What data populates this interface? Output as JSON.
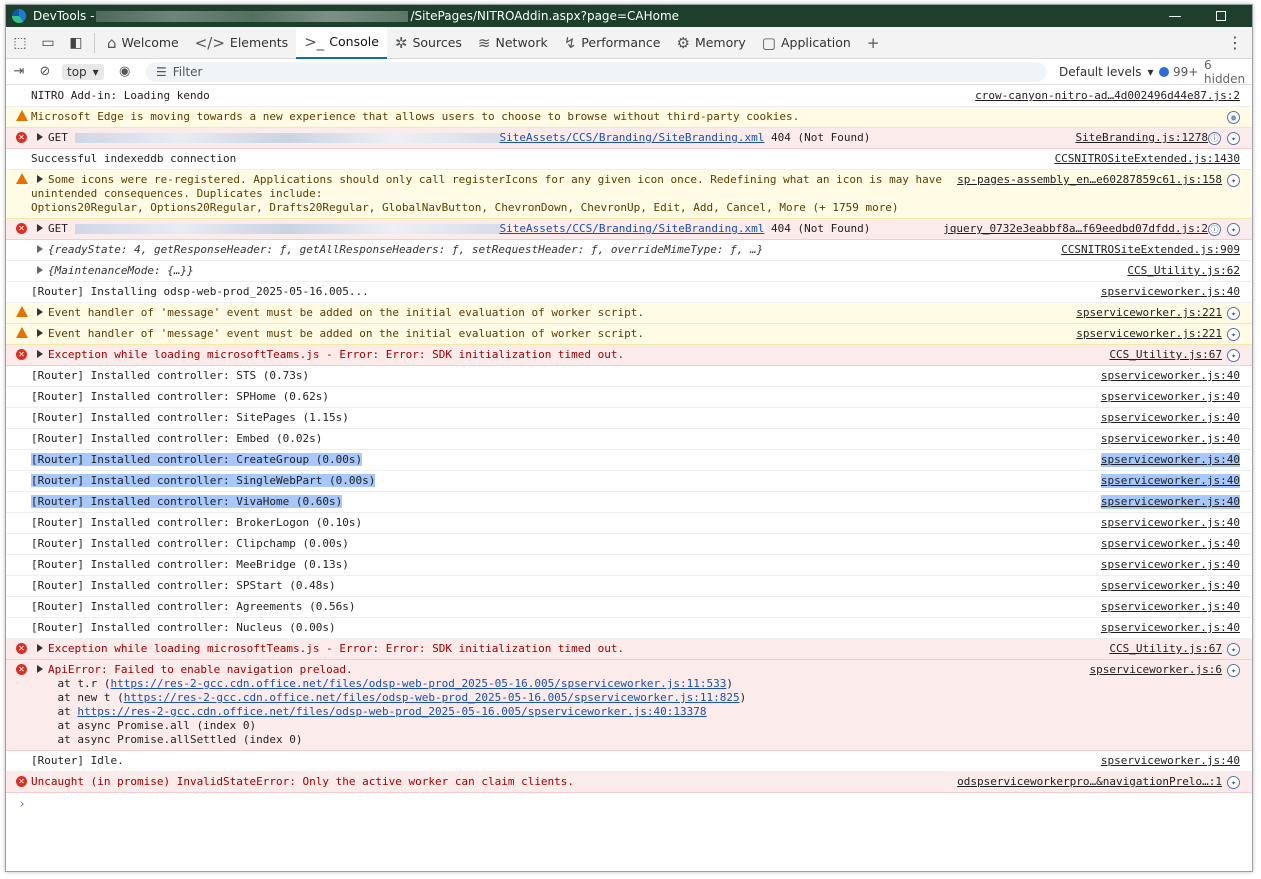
{
  "window": {
    "title_prefix": "DevTools - ",
    "title_suffix": "/SitePages/NITROAddin.aspx?page=CAHome",
    "min_symbol": "—",
    "max_symbol": ""
  },
  "tabs": [
    {
      "label": "Welcome",
      "icon": "home-icon"
    },
    {
      "label": "Elements",
      "icon": "code-icon"
    },
    {
      "label": "Console",
      "icon": "console-icon",
      "active": true
    },
    {
      "label": "Sources",
      "icon": "bug-icon"
    },
    {
      "label": "Network",
      "icon": "wifi-icon"
    },
    {
      "label": "Performance",
      "icon": "performance-icon"
    },
    {
      "label": "Memory",
      "icon": "memory-icon"
    },
    {
      "label": "Application",
      "icon": "application-icon"
    }
  ],
  "add_tab": "+",
  "more": "⋮",
  "toolbar": {
    "context": "top",
    "filter_placeholder": "Filter",
    "levels": "Default levels",
    "count": "99+",
    "hidden": "6 hidden"
  },
  "console": {
    "rows": [
      {
        "type": "log",
        "text": "NITRO Add-in: Loading kendo",
        "src": "crow-canyon-nitro-ad…4d002496d44e87.js:2"
      },
      {
        "type": "warn",
        "text": "Microsoft Edge is moving towards a new experience that allows users to choose to browse without third-party cookies.",
        "src": ""
      },
      {
        "type": "error",
        "prefix": "GET ",
        "link": "SiteAssets/CCS/Branding/SiteBranding.xml",
        "after": " 404 (Not Found)",
        "src": "SiteBranding.js:1278"
      },
      {
        "type": "log",
        "text": "Successful indexeddb connection",
        "src": "CCSNITROSiteExtended.js:1430"
      },
      {
        "type": "warn",
        "lines": [
          "Some icons were re-registered. Applications should only call registerIcons for any given icon once. Redefining what an icon is may have",
          "unintended consequences. Duplicates include:",
          "Options20Regular, Options20Regular, Drafts20Regular, GlobalNavButton, ChevronDown, ChevronUp, Edit, Add, Cancel, More (+ 1759 more)"
        ],
        "src": "sp-pages-assembly_en…e60287859c61.js:158"
      },
      {
        "type": "error",
        "prefix": "GET ",
        "link": "SiteAssets/CCS/Branding/SiteBranding.xml",
        "after": " 404 (Not Found)",
        "src": "jquery_0732e3eabbf8a…f69eedbd07dfdd.js:2"
      },
      {
        "type": "log",
        "text": "{readyState: 4, getResponseHeader: ƒ, getAllResponseHeaders: ƒ, setRequestHeader: ƒ, overrideMimeType: ƒ, …}",
        "src": "CCSNITROSiteExtended.js:909"
      },
      {
        "type": "log",
        "text": "{MaintenanceMode: {…}}",
        "src": "CCS_Utility.js:62"
      },
      {
        "type": "log",
        "text": "[Router] Installing odsp-web-prod_2025-05-16.005...",
        "src": "spserviceworker.js:40"
      },
      {
        "type": "warn",
        "text": "Event handler of 'message' event must be added on the initial evaluation of worker script.",
        "src": "spserviceworker.js:221"
      },
      {
        "type": "warn",
        "text": "Event handler of 'message' event must be added on the initial evaluation of worker script.",
        "src": "spserviceworker.js:221"
      },
      {
        "type": "error",
        "text": "Exception while loading microsoftTeams.js - Error: Error: SDK initialization timed out.",
        "src": "CCS_Utility.js:67"
      },
      {
        "type": "log",
        "text": "[Router] Installed controller: STS (0.73s)",
        "src": "spserviceworker.js:40"
      },
      {
        "type": "log",
        "text": "[Router] Installed controller: SPHome (0.62s)",
        "src": "spserviceworker.js:40"
      },
      {
        "type": "log",
        "text": "[Router] Installed controller: SitePages (1.15s)",
        "src": "spserviceworker.js:40"
      },
      {
        "type": "log",
        "text": "[Router] Installed controller: Embed (0.02s)",
        "src": "spserviceworker.js:40"
      },
      {
        "type": "log",
        "text": "[Router] Installed controller: CreateGroup (0.00s)",
        "src": "spserviceworker.js:40"
      },
      {
        "type": "log",
        "text": "[Router] Installed controller: SingleWebPart (0.00s)",
        "src": "spserviceworker.js:40"
      },
      {
        "type": "log",
        "text": "[Router] Installed controller: VivaHome (0.60s)",
        "src": "spserviceworker.js:40"
      },
      {
        "type": "log",
        "text": "[Router] Installed controller: BrokerLogon (0.10s)",
        "src": "spserviceworker.js:40"
      },
      {
        "type": "log",
        "text": "[Router] Installed controller: Clipchamp (0.00s)",
        "src": "spserviceworker.js:40"
      },
      {
        "type": "log",
        "text": "[Router] Installed controller: MeeBridge (0.13s)",
        "src": "spserviceworker.js:40"
      },
      {
        "type": "log",
        "text": "[Router] Installed controller: SPStart (0.48s)",
        "src": "spserviceworker.js:40"
      },
      {
        "type": "log",
        "text": "[Router] Installed controller: Agreements (0.56s)",
        "src": "spserviceworker.js:40"
      },
      {
        "type": "log",
        "text": "[Router] Installed controller: Nucleus (0.00s)",
        "src": "spserviceworker.js:40"
      },
      {
        "type": "error",
        "text": "Exception while loading microsoftTeams.js - Error: Error: SDK initialization timed out.",
        "src": "CCS_Utility.js:67"
      },
      {
        "type": "error",
        "head": "ApiError: Failed to enable navigation preload.",
        "stack": [
          {
            "pre": "    at t.r (",
            "link": "https://res-2-gcc.cdn.office.net/files/odsp-web-prod_2025-05-16.005/spserviceworker.js:11:533",
            "post": ")"
          },
          {
            "pre": "    at new t (",
            "link": "https://res-2-gcc.cdn.office.net/files/odsp-web-prod_2025-05-16.005/spserviceworker.js:11:825",
            "post": ")"
          },
          {
            "pre": "    at ",
            "link": "https://res-2-gcc.cdn.office.net/files/odsp-web-prod_2025-05-16.005/spserviceworker.js:40:13378",
            "post": ""
          },
          {
            "pre": "    at async Promise.all (index 0)",
            "link": "",
            "post": ""
          },
          {
            "pre": "    at async Promise.allSettled (index 0)",
            "link": "",
            "post": ""
          }
        ],
        "src": "spserviceworker.js:6"
      },
      {
        "type": "log",
        "text": "[Router] Idle.",
        "src": "spserviceworker.js:40"
      },
      {
        "type": "error",
        "text": "Uncaught (in promise) InvalidStateError: Only the active worker can claim clients.",
        "src": "odspserviceworkerpro…&navigationPrelo…:1"
      }
    ],
    "prompt": "›"
  }
}
